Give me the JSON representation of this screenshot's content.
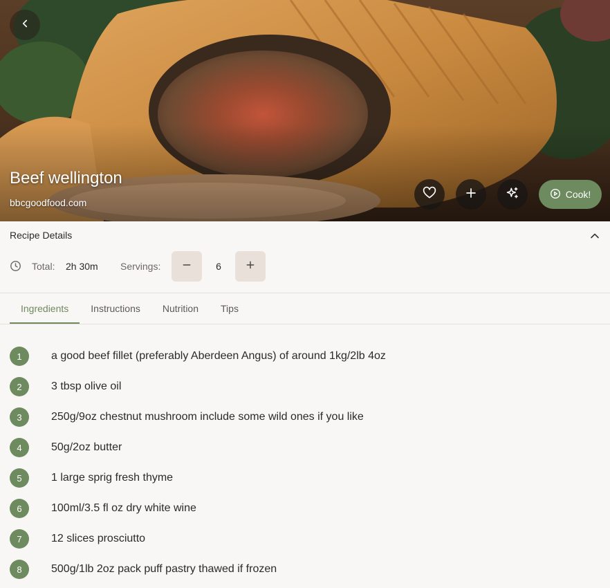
{
  "recipe": {
    "title": "Beef wellington",
    "source": "bbcgoodfood.com"
  },
  "actions": {
    "cook_label": "Cook!",
    "icons": [
      "back-icon",
      "heart-icon",
      "plus-icon",
      "sparkles-icon",
      "play-circle-icon"
    ]
  },
  "details": {
    "heading": "Recipe Details",
    "total_label": "Total:",
    "total_value": "2h 30m",
    "servings_label": "Servings:",
    "servings_value": "6"
  },
  "tabs": [
    {
      "label": "Ingredients",
      "active": true
    },
    {
      "label": "Instructions",
      "active": false
    },
    {
      "label": "Nutrition",
      "active": false
    },
    {
      "label": "Tips",
      "active": false
    }
  ],
  "ingredients": [
    {
      "num": "1",
      "text": "a good beef fillet (preferably Aberdeen Angus) of around 1kg/2lb 4oz"
    },
    {
      "num": "2",
      "text": "3 tbsp olive oil"
    },
    {
      "num": "3",
      "text": "250g/9oz chestnut mushroom include some wild ones if you like"
    },
    {
      "num": "4",
      "text": "50g/2oz butter"
    },
    {
      "num": "5",
      "text": "1 large sprig fresh thyme"
    },
    {
      "num": "6",
      "text": "100ml/3.5 fl oz dry white wine"
    },
    {
      "num": "7",
      "text": "12 slices prosciutto"
    },
    {
      "num": "8",
      "text": "500g/1lb 2oz pack puff pastry thawed if frozen"
    }
  ],
  "colors": {
    "accent": "#6e8a5f",
    "stepper_bg": "#e9e1d9",
    "page_bg": "#f9f7f5",
    "text": "#2c2a26"
  }
}
